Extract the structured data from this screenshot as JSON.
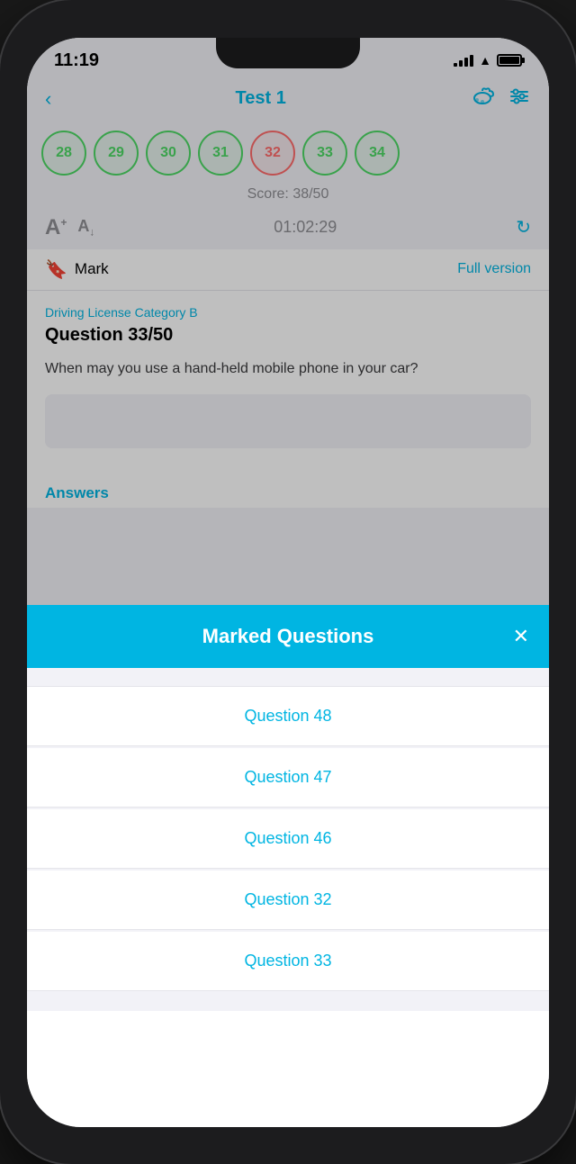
{
  "status": {
    "time": "11:19",
    "battery_indicator": "lock-icon"
  },
  "header": {
    "title": "Test 1",
    "back_label": "‹",
    "cloud_icon": "cloud-icon",
    "settings_icon": "settings-icon"
  },
  "question_pills": [
    {
      "number": "28",
      "state": "green"
    },
    {
      "number": "29",
      "state": "green"
    },
    {
      "number": "30",
      "state": "green"
    },
    {
      "number": "31",
      "state": "green"
    },
    {
      "number": "32",
      "state": "red"
    },
    {
      "number": "33",
      "state": "green"
    },
    {
      "number": "34",
      "state": "green"
    }
  ],
  "score": {
    "label": "Score: 38/50"
  },
  "controls": {
    "font_up_label": "A",
    "font_down_label": "A",
    "timer": "01:02:29",
    "refresh_icon": "refresh-icon"
  },
  "mark_row": {
    "bookmark_icon": "bookmark-icon",
    "mark_label": "Mark",
    "full_version_label": "Full version"
  },
  "question": {
    "category": "Driving License Category B",
    "number_label": "Question 33/50",
    "text": "When may you use a hand-held mobile phone in your car?"
  },
  "answers": {
    "label": "Answers"
  },
  "modal": {
    "title": "Marked Questions",
    "close_label": "✕",
    "items": [
      {
        "label": "Question 48"
      },
      {
        "label": "Question 47"
      },
      {
        "label": "Question 46"
      },
      {
        "label": "Question 32"
      },
      {
        "label": "Question 33"
      }
    ]
  }
}
